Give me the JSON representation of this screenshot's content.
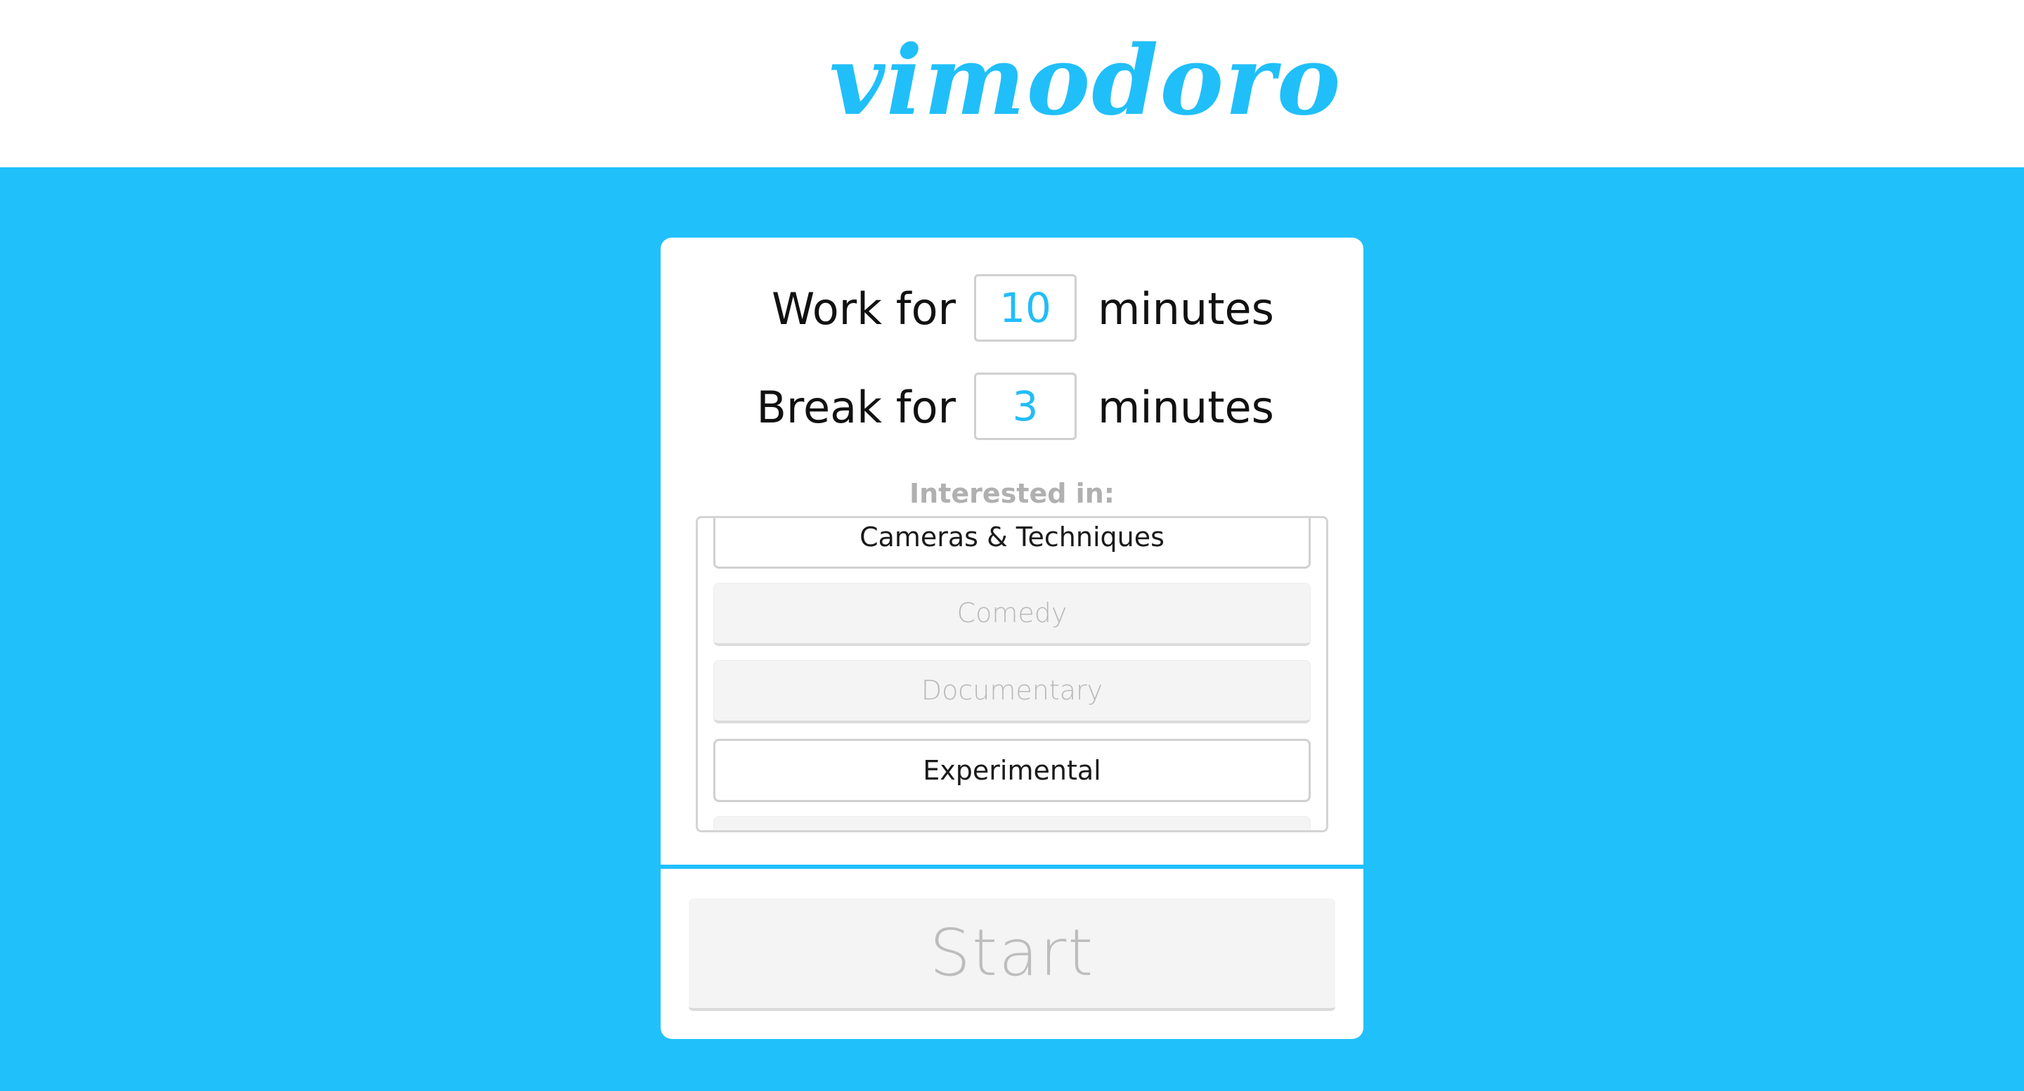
{
  "header": {
    "logo_text": "vimodoro"
  },
  "colors": {
    "brand": "#20c0fb",
    "number_text": "#22bdf8",
    "disabled_text": "#b8b8b8",
    "selected_item_border": "#d0d0d0"
  },
  "form": {
    "work": {
      "label": "Work for",
      "value": "10",
      "unit": "minutes"
    },
    "break": {
      "label": "Break for",
      "value": "3",
      "unit": "minutes"
    },
    "interested_label": "Interested in:",
    "categories": [
      {
        "label": "Cameras & Techniques",
        "selected": true
      },
      {
        "label": "Comedy",
        "selected": false
      },
      {
        "label": "Documentary",
        "selected": false
      },
      {
        "label": "Experimental",
        "selected": true
      },
      {
        "label": "",
        "selected": false
      }
    ],
    "start_label": "Start"
  }
}
